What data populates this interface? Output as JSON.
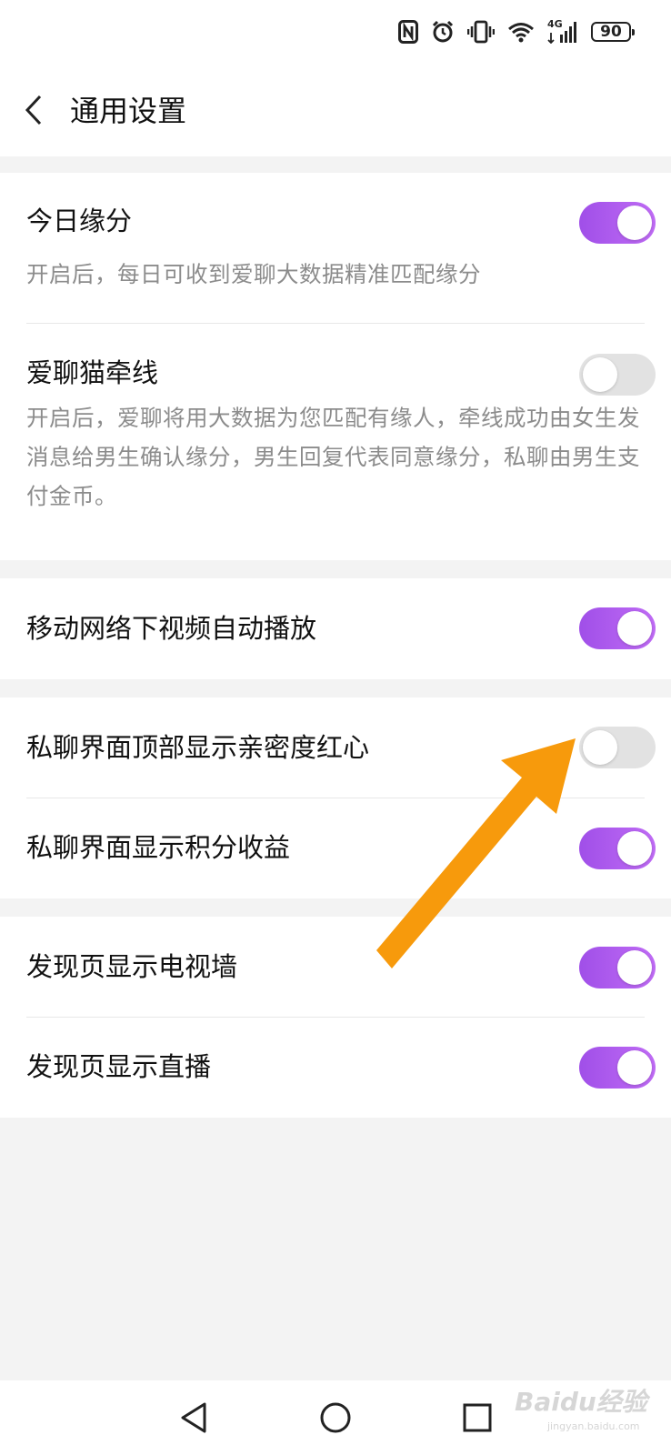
{
  "status_bar": {
    "battery_level": "90",
    "network": "4G",
    "icons": [
      "nfc-icon",
      "alarm-icon",
      "vibrate-icon",
      "wifi-icon",
      "signal-icon",
      "battery-icon"
    ]
  },
  "header": {
    "title": "通用设置",
    "back_icon": "chevron-left-icon"
  },
  "settings": {
    "daily_match": {
      "title": "今日缘分",
      "desc": "开启后，每日可收到爱聊大数据精准匹配缘分",
      "enabled": true
    },
    "matchmaker": {
      "title": "爱聊猫牵线",
      "desc": "开启后，爱聊将用大数据为您匹配有缘人，牵线成功由女生发消息给男生确认缘分，男生回复代表同意缘分，私聊由男生支付金币。",
      "enabled": false
    },
    "autoplay": {
      "title": "移动网络下视频自动播放",
      "enabled": true
    },
    "intimacy_heart": {
      "title": "私聊界面顶部显示亲密度红心",
      "enabled": false
    },
    "points_income": {
      "title": "私聊界面显示积分收益",
      "enabled": true
    },
    "tv_wall": {
      "title": "发现页显示电视墙",
      "enabled": true
    },
    "live": {
      "title": "发现页显示直播",
      "enabled": true
    }
  },
  "annotation": {
    "arrow_color": "#f79a0c",
    "points_to": "intimacy_heart"
  },
  "colors": {
    "toggle_on": "#b25ff0",
    "toggle_off": "#e2e2e2",
    "background": "#f3f3f3"
  },
  "nav_bar": {
    "icons": [
      "back-triangle-icon",
      "home-circle-icon",
      "recents-square-icon"
    ]
  },
  "watermark": {
    "text": "Baidu经验",
    "sub": "jingyan.baidu.com"
  }
}
